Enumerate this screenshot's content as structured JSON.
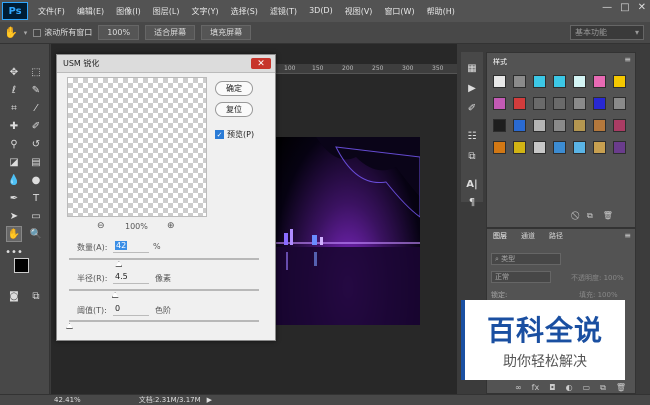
{
  "app": {
    "logo": "Ps"
  },
  "menu": [
    "文件(F)",
    "编辑(E)",
    "图像(I)",
    "图层(L)",
    "文字(Y)",
    "选择(S)",
    "滤镜(T)",
    "3D(D)",
    "视图(V)",
    "窗口(W)",
    "帮助(H)"
  ],
  "options": {
    "scroll_all": "滚动所有窗口",
    "zoom": "100%",
    "fit_screen": "适合屏幕",
    "fill_screen": "填充屏幕",
    "workspace": "基本功能"
  },
  "ruler": {
    "ticks": [
      "100",
      "150",
      "200",
      "250",
      "300",
      "350"
    ]
  },
  "dialog": {
    "title": "USM 锐化",
    "ok": "确定",
    "reset": "复位",
    "preview_label": "预览(P)",
    "preview_checked": true,
    "zoom": "100%",
    "amount": {
      "label": "数量(A):",
      "value": "42",
      "unit": "%",
      "level": 0.26
    },
    "radius": {
      "label": "半径(R):",
      "value": "4.5",
      "unit": "像素",
      "level": 0.24
    },
    "threshold": {
      "label": "阈值(T):",
      "value": "0",
      "unit": "色阶",
      "level": 0.0
    }
  },
  "panels": {
    "swatch_tab": "样式",
    "layers_tabs": [
      "图层",
      "通道",
      "路径"
    ],
    "kind_filter": "类型",
    "blend_mode": "正常",
    "opacity_label": "不透明度: 100%",
    "lock_label": "锁定:",
    "fill_label": "填充: 100%"
  },
  "swatch_colors": [
    "#e8e8e8",
    "#8b8b8b",
    "#3cc8e6",
    "#3cc8e6",
    "#d4f5f5",
    "#e86ab4",
    "#f5c800",
    "#c35ab4",
    "#d23c3c",
    "#6a6a6a",
    "#6a6a6a",
    "#8a8a8a",
    "#2828d2",
    "#8a8a8a",
    "#1e1e1e",
    "#2a6ad2",
    "#b4b4b4",
    "#8a8a8a",
    "#b49650",
    "#b4783c",
    "#aa3c64",
    "#d27814",
    "#d2b414",
    "#c8c8c8",
    "#3c8cd2",
    "#5ab4e6",
    "#c8a050",
    "#6a3c8c"
  ],
  "status": {
    "zoom": "42.41%",
    "doc": "文档:2.31M/3.17M"
  },
  "watermark": {
    "main": "百科全说",
    "sub": "助你轻松解决"
  },
  "colors": {
    "accent": "#31a8ff",
    "close": "#c7342b",
    "watermark_blue": "#1a4fa1"
  }
}
